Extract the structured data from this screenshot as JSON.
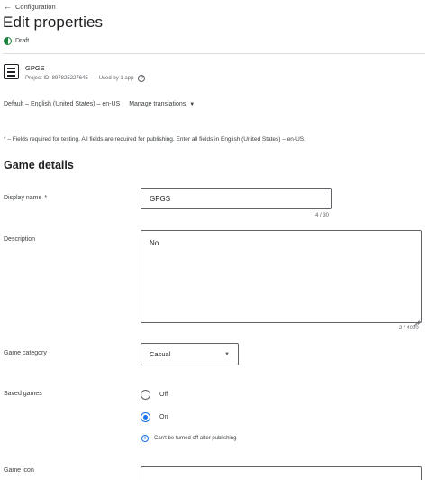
{
  "header": {
    "back_label": "Configuration",
    "title": "Edit properties",
    "status": "Draft"
  },
  "game": {
    "name": "GPGS",
    "project_id": "Project ID: 897825227645",
    "used_by": "Used by 1 app"
  },
  "language": {
    "default": "Default – English (United States) – en-US",
    "manage_label": "Manage translations"
  },
  "required_note": "* – Fields required for testing. All fields are required for publishing. Enter all fields in English (United States) – en-US.",
  "section_title": "Game details",
  "form": {
    "display_name": {
      "label": "Display name",
      "required_mark": "*",
      "value": "GPGS",
      "counter": "4 / 30"
    },
    "description": {
      "label": "Description",
      "value": "No",
      "counter": "2 / 4000"
    },
    "category": {
      "label": "Game category",
      "value": "Casual"
    },
    "saved_games": {
      "label": "Saved games",
      "options": [
        {
          "label": "Off",
          "checked": false
        },
        {
          "label": "On",
          "checked": true
        }
      ],
      "info": "Can't be turned off after publishing"
    },
    "game_icon": {
      "label": "Game icon"
    }
  },
  "colors": {
    "accent": "#1a73e8",
    "draft_green": "#188038",
    "border": "#5f6368",
    "divider": "#dadce0"
  }
}
